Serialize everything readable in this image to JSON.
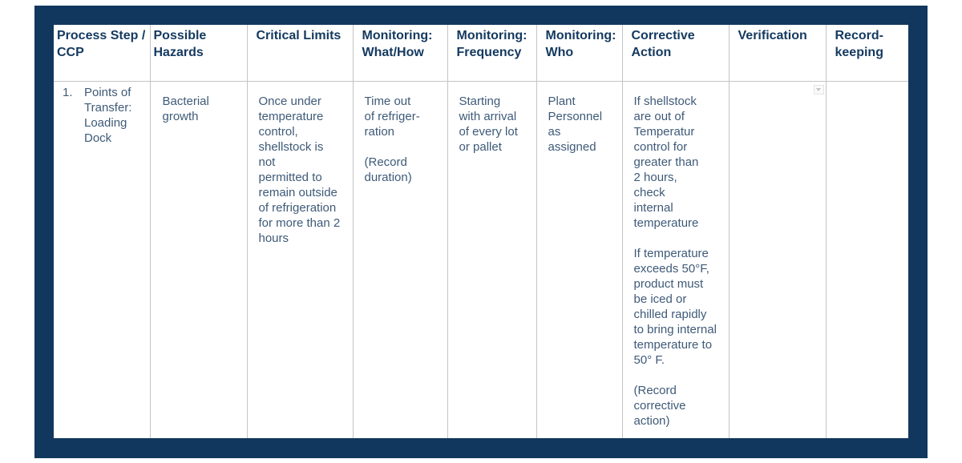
{
  "table": {
    "headers": [
      "Process Step / CCP",
      "Possible Hazards",
      "Critical Limits",
      "Monitoring: What/How",
      "Monitoring: Frequency",
      "Monitoring: Who",
      "Corrective Action",
      "Verification",
      "Record-keeping"
    ],
    "rows": [
      {
        "step_number": "1.",
        "process_step": "Points of\nTransfer:\nLoading\nDock",
        "possible_hazards": "Bacterial\ngrowth",
        "critical_limits": "Once under\ntemperature\ncontrol,\nshellstock is\nnot\npermitted to\nremain outside\nof refrigeration\nfor more than 2\nhours",
        "monitoring_what_how": "Time out\nof refriger-\nration\n\n(Record\nduration)",
        "monitoring_frequency": "Starting\nwith arrival\nof every lot\nor pallet",
        "monitoring_who": "Plant\nPersonnel\nas\nassigned",
        "corrective_action": "If shellstock\nare out of\nTemperatur\ncontrol for\ngreater than\n2 hours,\ncheck\ninternal\ntemperature\n\nIf temperature\nexceeds 50°F,\nproduct must\nbe iced or\nchilled rapidly\nto bring internal\ntemperature to\n50° F.\n\n(Record\ncorrective\naction)",
        "verification": "",
        "recordkeeping": "",
        "verification_control_icon": "dropdown-arrow"
      }
    ]
  },
  "colors": {
    "frame": "#12375e",
    "header_text": "#14395f",
    "body_text": "#3e5a78",
    "grid": "#c4c4c4"
  }
}
